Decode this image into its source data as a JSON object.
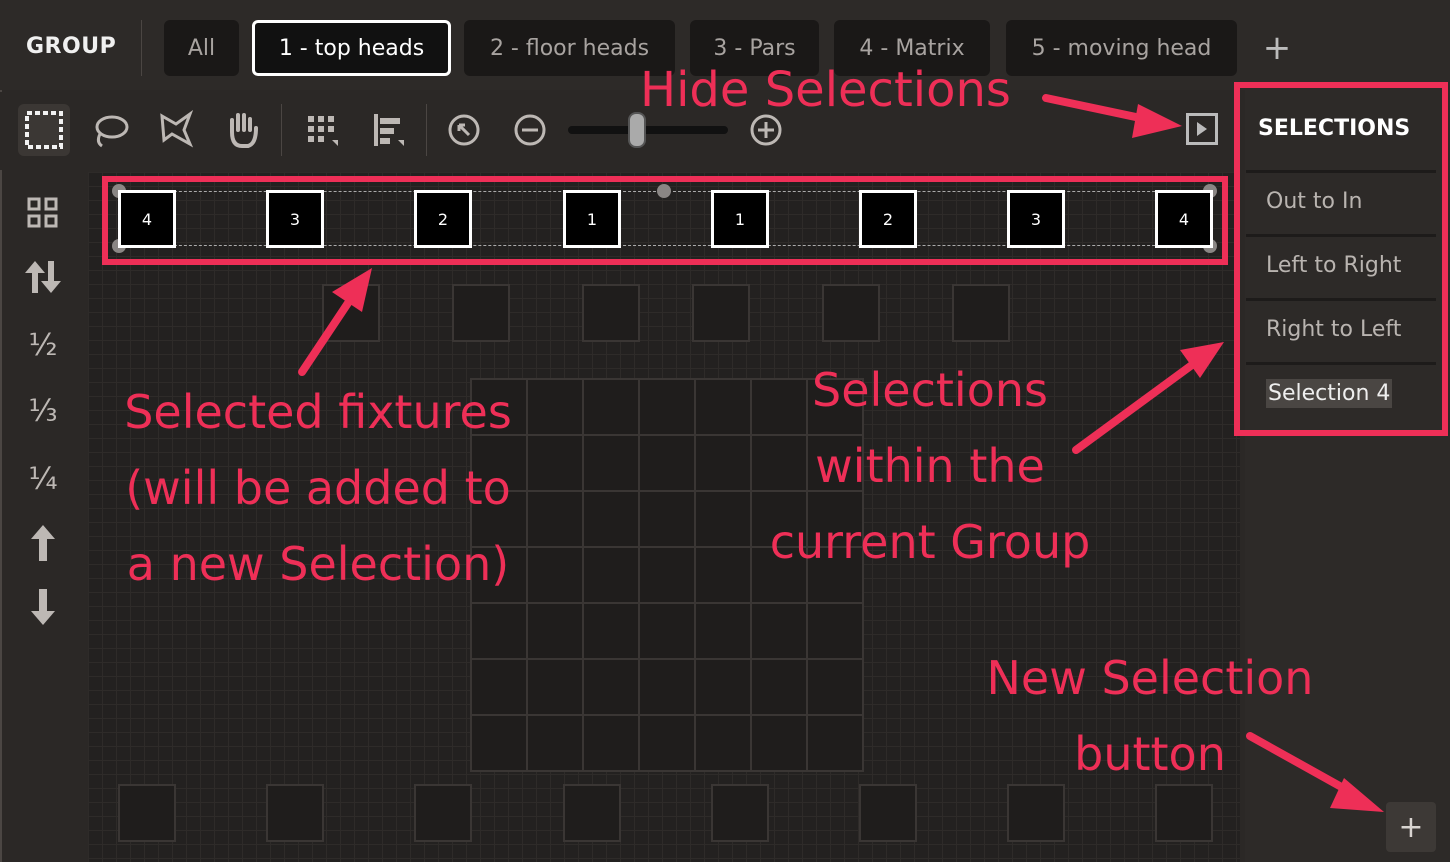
{
  "header": {
    "group_label": "GROUP",
    "tabs": [
      {
        "label": "All"
      },
      {
        "label": "1 - top heads"
      },
      {
        "label": "2 - floor heads"
      },
      {
        "label": "3 - Pars"
      },
      {
        "label": "4 - Matrix"
      },
      {
        "label": "5 - moving head"
      }
    ],
    "active_tab": "1 - top heads",
    "add_tab_label": "+"
  },
  "toolbar": {
    "tools": [
      "select-rect-icon",
      "lasso-icon",
      "polygon-select-icon",
      "hand-pan-icon",
      "grid-layout-icon",
      "align-icon",
      "zoom-reset-icon",
      "zoom-out-icon",
      "zoom-in-icon"
    ],
    "zoom_level": 0.4
  },
  "leftbar": {
    "buttons": [
      "grid-icon",
      "flip-icon",
      "½",
      "⅓",
      "¼",
      "↑",
      "↓"
    ]
  },
  "canvas": {
    "selected_fixtures": [
      "4",
      "3",
      "2",
      "1",
      "1",
      "2",
      "3",
      "4"
    ]
  },
  "selections_panel": {
    "title": "SELECTIONS",
    "items": [
      "Out to In",
      "Left to Right",
      "Right to Left",
      "Selection 4"
    ],
    "new_button_label": "+"
  },
  "annotations": {
    "hide_selections": "Hide Selections",
    "selected_fixtures": [
      "Selected fixtures",
      "(will be added to",
      "a new Selection)"
    ],
    "selections_within": [
      "Selections",
      "within the",
      "current Group"
    ],
    "new_selection": [
      "New Selection",
      "button"
    ],
    "color": "#ee2f57"
  }
}
